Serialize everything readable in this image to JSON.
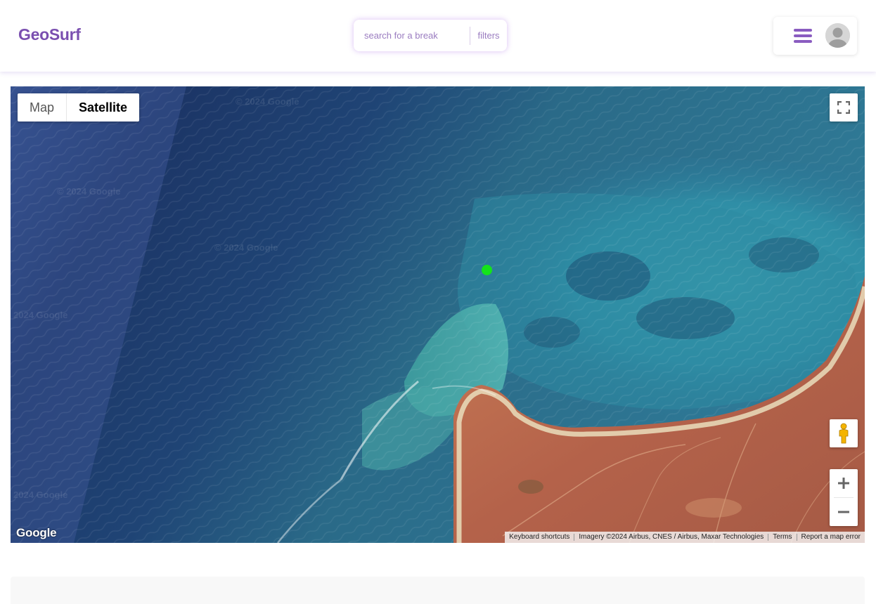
{
  "header": {
    "logo": "GeoSurf",
    "search": {
      "placeholder": "search for a break",
      "value": ""
    },
    "filters_label": "filters",
    "menu_icon": "hamburger-menu-icon",
    "avatar_icon": "user-avatar-icon"
  },
  "map": {
    "type_control": {
      "map_label": "Map",
      "satellite_label": "Satellite",
      "active": "Satellite"
    },
    "fullscreen_icon": "fullscreen-icon",
    "pegman_icon": "street-view-pegman-icon",
    "zoom_in_icon": "plus-icon",
    "zoom_out_icon": "minus-icon",
    "marker": {
      "icon": "surf-break-marker",
      "color": "#14e31a"
    },
    "google_logo": "Google",
    "attribution": {
      "shortcuts": "Keyboard shortcuts",
      "imagery": "Imagery ©2024 Airbus, CNES / Airbus, Maxar Technologies",
      "terms": "Terms",
      "report": "Report a map error"
    },
    "watermarks": [
      "© 2024 Google",
      "© 2024 Google",
      "2024 Google",
      "© 2024 Google",
      "2024 Google"
    ]
  },
  "colors": {
    "brand": "#7a4fb0",
    "accent_glow": "#aa6ee6",
    "menu_icon": "#8a5cc0",
    "marker": "#14e31a"
  }
}
